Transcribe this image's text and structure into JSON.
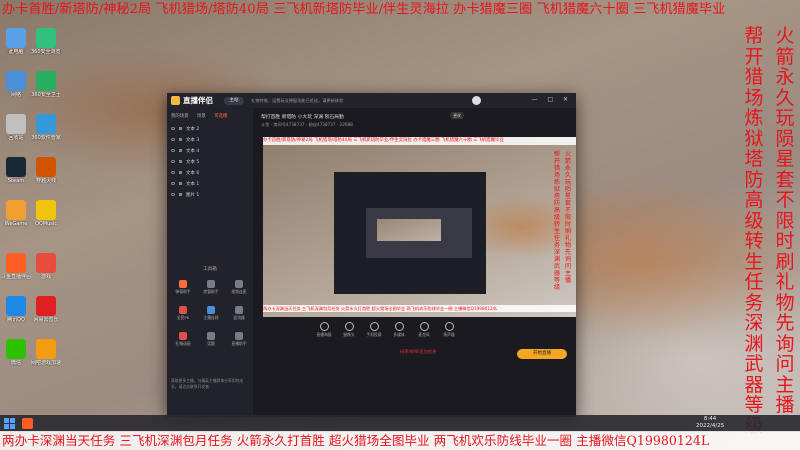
{
  "overlay": {
    "top_text": "办卡首胜/新塔防/神秘2局 飞机猎场/塔防40局 三飞机新塔防毕业/伴生灵海拉 办卡猎魔三圈 飞机猎魔六十圈 三飞机猎魔毕业",
    "bottom_text": "两办卡深渊当天任务 三飞机深渊包月任务 火箭永久打首胜 超火猎场全图毕业 两飞机欢乐防线毕业一圈 主播微信Q19980124L",
    "right_col_1": "帮开猎场炼狱 塔防高级 转生任务 深渊武器等级",
    "right_col_2": "火箭永久玩陨星套不限时刷礼物先询问主播"
  },
  "desktop_icons": [
    {
      "label": "此电脑",
      "color": "#5aa0e8"
    },
    {
      "label": "360安全浏览器",
      "color": "#2ec27e"
    },
    {
      "label": "网络",
      "color": "#4a90d9"
    },
    {
      "label": "360安全卫士",
      "color": "#27ae60"
    },
    {
      "label": "回收站",
      "color": "#c0c0c0"
    },
    {
      "label": "360软件管家",
      "color": "#3498db"
    },
    {
      "label": "Steam",
      "color": "#1b2838"
    },
    {
      "label": "穿越火线",
      "color": "#d35400"
    },
    {
      "label": "WeGame",
      "color": "#f0a030"
    },
    {
      "label": "QQMusic",
      "color": "#f1c40f"
    },
    {
      "label": "斗鱼直播伴侣",
      "color": "#ff5d23"
    },
    {
      "label": "游戏",
      "color": "#e74c3c"
    },
    {
      "label": "腾讯QQ",
      "color": "#1e88e5"
    },
    {
      "label": "网易云音乐",
      "color": "#e02020"
    },
    {
      "label": "微信",
      "color": "#2dc100"
    },
    {
      "label": "网吧游戏加速",
      "color": "#f39c12"
    }
  ],
  "app": {
    "name": "直播伴侣",
    "pill": "主站",
    "notice": "礼物特效、设置玩法弹窗功能已优化，请更新体验",
    "win_controls": "— □ ✕",
    "sidebar_tabs": [
      "我的场景",
      "场景",
      "可选模"
    ],
    "scenes": [
      "文本 2",
      "文本 3",
      "文本 4",
      "文本 5",
      "文本 6",
      "文本 1",
      "图片 1"
    ],
    "tools_title": "工具箱",
    "tools": [
      "弹幕助手",
      "房管助手",
      "视频连麦",
      "全民PK",
      "主播连线",
      "混流器",
      "礼物动画",
      "话题",
      "直播助手"
    ],
    "sidebar_bottom": "获取更多主播，与精英主播群体分享如何成长，请点击联系开发者",
    "room_title": "帮打首胜 新塔防 小大玩 深渊 陨石局勤",
    "room_sub": "斗鱼 · 房间号4738737 · 粉丝4738737 · 22688",
    "room_pill": "更改",
    "controls": [
      "直播海报",
      "摄像头",
      "手机投屏",
      "多媒体",
      "麦克风",
      "扬声器"
    ],
    "status_text": "码率/帧率/丢包信息",
    "start_label": "开始直播"
  },
  "taskbar": {
    "time": "8:44",
    "date": "2022/4/25"
  }
}
